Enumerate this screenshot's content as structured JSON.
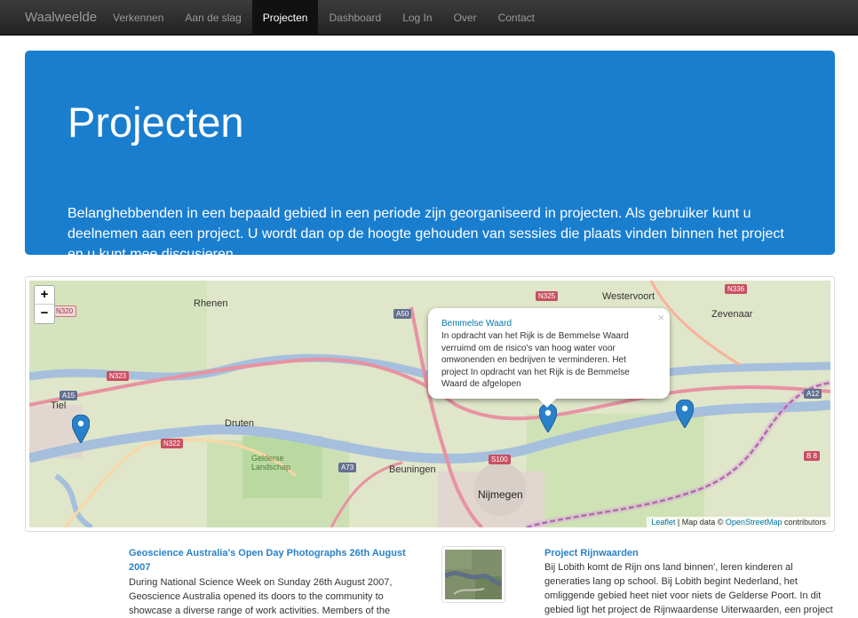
{
  "navbar": {
    "brand": "Waalweelde",
    "items": [
      {
        "label": "Verkennen",
        "active": false
      },
      {
        "label": "Aan de slag",
        "active": false
      },
      {
        "label": "Projecten",
        "active": true
      },
      {
        "label": "Dashboard",
        "active": false
      },
      {
        "label": "Log In",
        "active": false
      },
      {
        "label": "Over",
        "active": false
      },
      {
        "label": "Contact",
        "active": false
      }
    ]
  },
  "hero": {
    "title": "Projecten",
    "text": "Belanghebbenden in een bepaald gebied in een periode zijn georganiseerd in projecten. Als gebruiker kunt u deelnemen aan een project. U wordt dan op de hoogte gehouden van sessies die plaats vinden binnen het project en u kunt mee discusieren."
  },
  "map": {
    "zoom_in": "+",
    "zoom_out": "−",
    "places": [
      "Rhenen",
      "Tiel",
      "Druten",
      "Beuningen",
      "Nijmegen",
      "Westervoort",
      "Zevenaar",
      "Gelderse Landschap"
    ],
    "roads": [
      "N320",
      "A15",
      "N323",
      "A50",
      "N325",
      "N336",
      "A12",
      "N322",
      "A73",
      "S100",
      "B 8"
    ],
    "popup": {
      "close": "×",
      "title": "Bemmelse Waard",
      "text": "In opdracht van het Rijk is de Bemmelse Waard verruimd om de risico's van hoog water voor omwonenden en bedrijven te verminderen. Het project In opdracht van het Rijk is de Bemmelse Waard de afgelopen"
    },
    "attribution": {
      "leaflet": "Leaflet",
      "sep": " | Map data © ",
      "osm": "OpenStreetMap",
      "suffix": " contributors"
    },
    "marker_color": "#2a81cb"
  },
  "articles": {
    "left": {
      "title": "Geoscience Australia's Open Day Photographs 26th August 2007",
      "text": "During National Science Week on Sunday 26th August 2007, Geoscience Australia opened its doors to the community to showcase a diverse range of work activities. Members of the"
    },
    "right": {
      "title": "Project Rijnwaarden",
      "text": "Bij Lobith komt de Rijn ons land binnen', leren kinderen al generaties lang op school. Bij Lobith begint Nederland, het omliggende gebied heet niet voor niets de Gelderse Poort. In dit gebied ligt het project de Rijnwaardense Uiterwaarden, een project voor"
    }
  }
}
